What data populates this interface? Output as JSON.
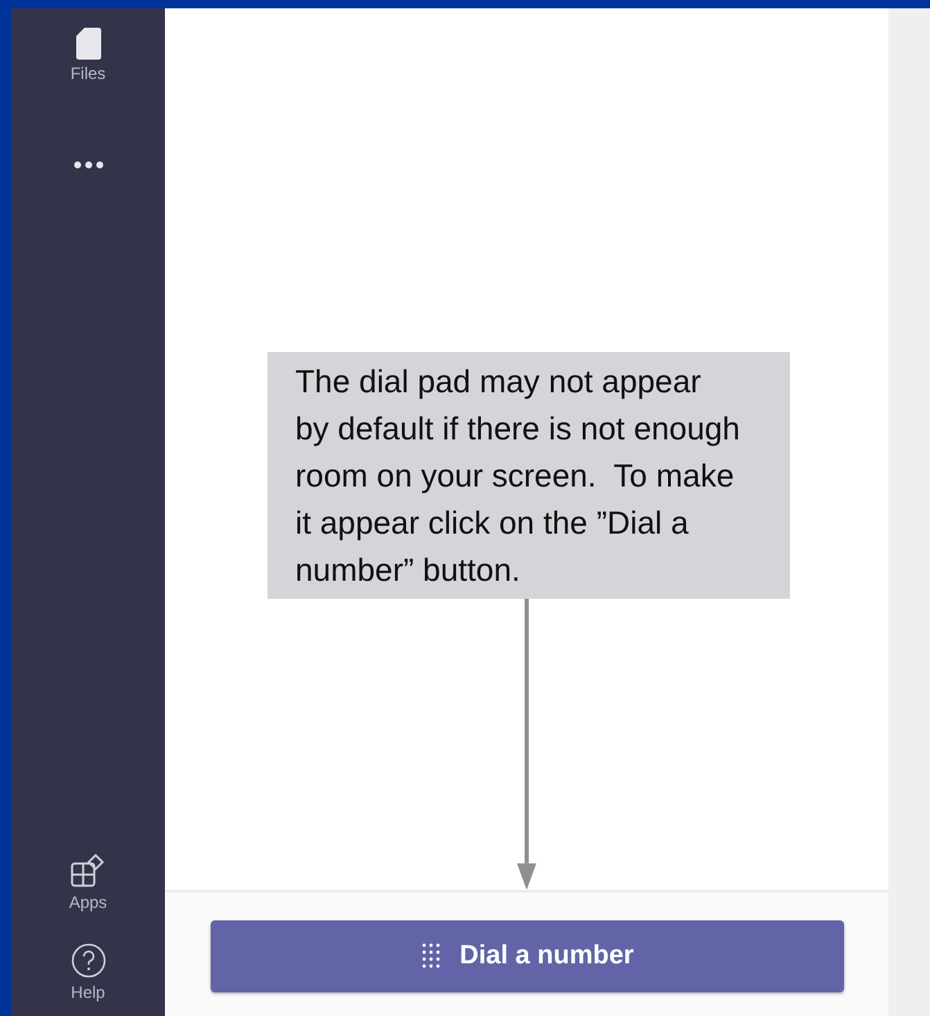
{
  "sidebar": {
    "items": [
      {
        "kind": "files",
        "label": "Files"
      },
      {
        "kind": "more"
      }
    ],
    "bottom_items": [
      {
        "kind": "apps",
        "label": "Apps"
      },
      {
        "kind": "help",
        "label": "Help"
      }
    ]
  },
  "callout": {
    "text": "The dial pad may not appear by default if there is not enough room on your screen.  To make it appear click on the ”Dial a number” button."
  },
  "dial_button": {
    "label": "Dial a number"
  }
}
